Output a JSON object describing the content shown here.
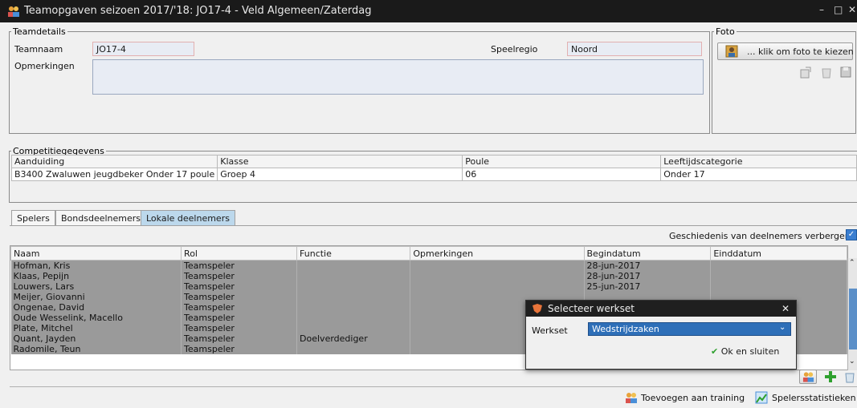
{
  "window": {
    "title": "Teamopgaven seizoen 2017/'18: JO17-4 - Veld Algemeen/Zaterdag",
    "minimize": "–",
    "maximize": "□",
    "close": "✕"
  },
  "teamdetails": {
    "legend": "Teamdetails",
    "teamnaam_label": "Teamnaam",
    "teamnaam_value": "JO17-4",
    "speelregio_label": "Speelregio",
    "speelregio_value": "Noord",
    "opmerkingen_label": "Opmerkingen",
    "opmerkingen_value": ""
  },
  "foto": {
    "legend": "Foto",
    "choose_label": "... klik om foto te kiezen"
  },
  "competitie": {
    "legend": "Competitiegegevens",
    "columns": [
      "Aanduiding",
      "Klasse",
      "Poule",
      "Leeftijdscategorie"
    ],
    "rows": [
      [
        "B3400 Zwaluwen jeugdbeker Onder 17 poule",
        "Groep 4",
        "06",
        "Onder 17"
      ]
    ]
  },
  "tabs": [
    {
      "label": "Spelers"
    },
    {
      "label": "Bondsdeelnemers"
    },
    {
      "label": "Lokale deelnemers"
    }
  ],
  "hide_history_label": "Geschiedenis van deelnemers verbergen?",
  "hide_history_checked": true,
  "players": {
    "columns": [
      "Naam",
      "Rol",
      "Functie",
      "Opmerkingen",
      "Begindatum",
      "Einddatum"
    ],
    "rows": [
      [
        "Hofman, Kris",
        "Teamspeler",
        "",
        "",
        "28-jun-2017",
        ""
      ],
      [
        "Klaas, Pepijn",
        "Teamspeler",
        "",
        "",
        "28-jun-2017",
        ""
      ],
      [
        "Louwers, Lars",
        "Teamspeler",
        "",
        "",
        "25-jun-2017",
        ""
      ],
      [
        "Meijer, Giovanni",
        "Teamspeler",
        "",
        "",
        "",
        ""
      ],
      [
        "Ongenae, David",
        "Teamspeler",
        "",
        "",
        "",
        ""
      ],
      [
        "Oude Wesselink, Macello",
        "Teamspeler",
        "",
        "",
        "",
        ""
      ],
      [
        "Plate, Mitchel",
        "Teamspeler",
        "",
        "",
        "",
        ""
      ],
      [
        "Quant, Jayden",
        "Teamspeler",
        "Doelverdediger",
        "",
        "",
        ""
      ],
      [
        "Radomile, Teun",
        "Teamspeler",
        "",
        "",
        "",
        ""
      ]
    ]
  },
  "dialog": {
    "title": "Selecteer werkset",
    "werkset_label": "Werkset",
    "werkset_value": "Wedstrijdzaken",
    "ok_label": "Ok en sluiten",
    "close": "✕"
  },
  "bottom": {
    "training_label": "Toevoegen aan training",
    "stats_label": "Spelersstatistieken"
  },
  "colors": {
    "titlebar": "#1a1a1a",
    "active_tab": "#bcd8ec",
    "field_bg": "#e8ecf4",
    "grid_row": "#9a9a9a",
    "dialog_select": "#2e6fb8"
  }
}
